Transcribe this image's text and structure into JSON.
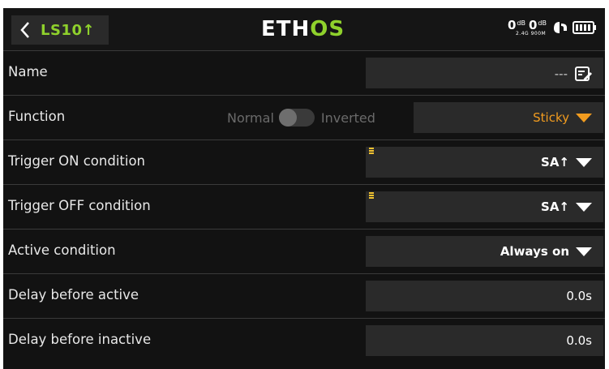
{
  "header": {
    "back_label": "LS10↑",
    "logo_main": "ETH",
    "logo_accent": "OS",
    "rssi": {
      "value_24": "0",
      "value_900": "0",
      "unit": "dB",
      "band_24": "2.4G",
      "band_900": "900M"
    }
  },
  "rows": {
    "name": {
      "label": "Name",
      "value": "---"
    },
    "function": {
      "label": "Function",
      "normal": "Normal",
      "inverted": "Inverted",
      "value": "Sticky",
      "inverted_on": false
    },
    "trigger_on": {
      "label": "Trigger ON condition",
      "value": "SA↑"
    },
    "trigger_off": {
      "label": "Trigger OFF condition",
      "value": "SA↑"
    },
    "active": {
      "label": "Active condition",
      "value": "Always on"
    },
    "delay_active": {
      "label": "Delay before active",
      "value": "0.0s"
    },
    "delay_inactive": {
      "label": "Delay before inactive",
      "value": "0.0s"
    }
  },
  "colors": {
    "accent_green": "#8fd12c",
    "accent_orange": "#f29c1f",
    "background": "#121212",
    "field": "#2a2a2a"
  }
}
